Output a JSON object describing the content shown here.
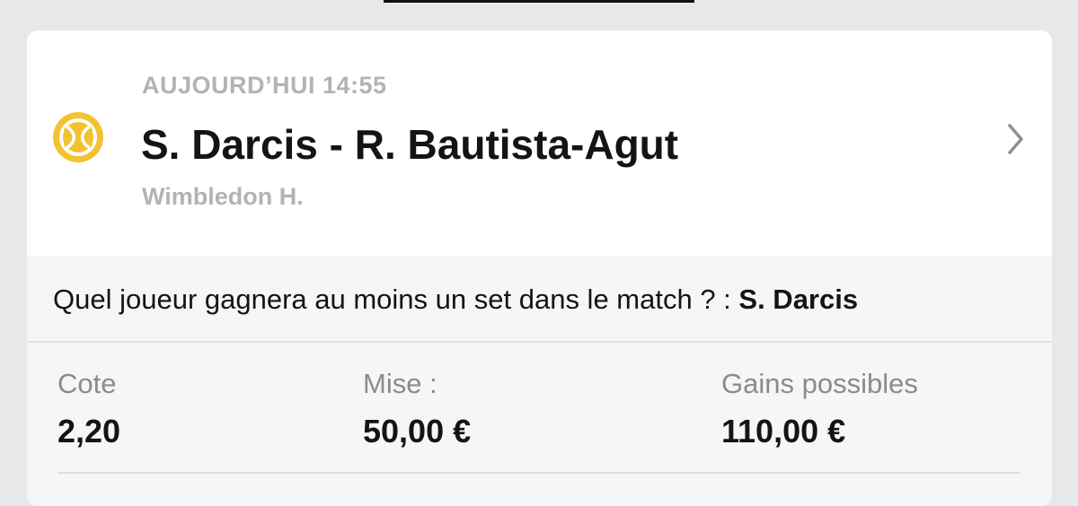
{
  "event": {
    "datetime": "AUJOURD’HUI 14:55",
    "match": "S. Darcis - R. Bautista-Agut",
    "tournament": "Wimbledon H.",
    "sport_icon": "tennis-ball-icon",
    "chevron_icon": "chevron-right-icon"
  },
  "bet": {
    "question": "Quel joueur gagnera au moins un set dans le match ? : ",
    "selection": "S. Darcis"
  },
  "stats": {
    "cote_label": "Cote",
    "cote_value": "2,20",
    "mise_label": "Mise :",
    "mise_value": "50,00 €",
    "gains_label": "Gains possibles",
    "gains_value": "110,00 €"
  },
  "colors": {
    "accent_yellow": "#f2c230",
    "muted_text": "#b3b3b3",
    "panel_bg": "#f6f6f8"
  }
}
